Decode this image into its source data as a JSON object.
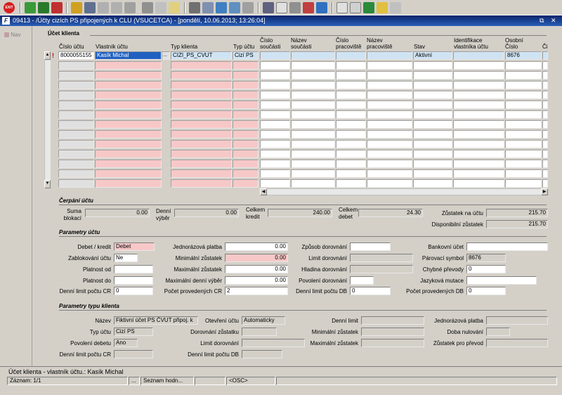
{
  "toolbar": {
    "exit_label": "EXIT",
    "icons": [
      "exit-icon",
      "add-record-icon",
      "save-icon",
      "delete-icon",
      "find-icon",
      "query-icon",
      "sort-asc-icon",
      "sort-desc-icon",
      "filter-icon",
      "print-icon",
      "copy-icon",
      "mail-icon",
      "cut-icon",
      "paste-icon",
      "lookup-icon",
      "attach-icon",
      "grid-icon",
      "calc-icon",
      "document-icon",
      "tools-icon",
      "chart-icon",
      "edit-icon",
      "refresh-icon",
      "sum-icon",
      "excel-icon",
      "help-icon",
      "context-help-icon"
    ]
  },
  "window": {
    "title": "09413 - /Účty cizích PS připojených k CLU (VSUCETCA) - [pondělí, 10.06.2013; 13:26:04]",
    "icon_letter": "F",
    "restore_glyph": "⧉",
    "close_glyph": "✕"
  },
  "nav": {
    "label": "Nav"
  },
  "account": {
    "section": "Účet klienta",
    "headers": {
      "cislo_uctu": "Číslo účtu",
      "vlastnik": "Vlastník účtu",
      "typ_klienta": "Typ klienta",
      "typ_uctu": "Typ účtu",
      "cislo_soucasti_1": "Číslo",
      "cislo_soucasti_2": "součásti",
      "nazev_soucasti_1": "Název",
      "nazev_soucasti_2": "součásti",
      "cislo_prac_1": "Číslo",
      "cislo_prac_2": "pracoviště",
      "nazev_prac_1": "Název",
      "nazev_prac_2": "pracoviště",
      "stav": "Stav",
      "identifikace_1": "Identifikace",
      "identifikace_2": "vlastníka účtu",
      "osobni_1": "Osobní",
      "osobni_2": "Číslo",
      "ci": "Či"
    },
    "row": {
      "marker": "!",
      "cislo_uctu": "8000055155",
      "vlastnik": "Kasík Michal",
      "ellipsis": "...",
      "typ_klienta": "CIZI_PS_CVUT",
      "typ_uctu": "Cizí PS",
      "stav": "Aktivní",
      "osobni": "8676"
    }
  },
  "cerpani": {
    "section": "Čerpání účtu",
    "suma_label_1": "Suma",
    "suma_label_2": "blokací",
    "suma_value": "0.00",
    "vyber_label_1": "Denní",
    "vyber_label_2": "výběr",
    "vyber_value": "0.00",
    "kredit_label_1": "Celkem",
    "kredit_label_2": "kredit",
    "kredit_value": "240.00",
    "debet_label_1": "Celkem",
    "debet_label_2": "debet",
    "debet_value": "24.30",
    "zustatek_label": "Zůstatek na účtu",
    "zustatek_value": "215.70",
    "disponibilni_label": "Disponibilní zůstatek",
    "disponibilni_value": "215.70"
  },
  "parametry": {
    "section": "Parametry účtu",
    "debet_kredit_label": "Debet / kredit",
    "debet_kredit_value": "Debet",
    "zablokovani_label": "Zablokování účtu",
    "zablokovani_value": "Ne",
    "platnost_od_label": "Platnost od",
    "platnost_do_label": "Platnost do",
    "denni_limit_cr_label": "Denní limit počtu CR",
    "denni_limit_cr_value": "0",
    "jednorazova_label": "Jednorázová platba",
    "jednorazova_value": "0.00",
    "min_zustatek_label": "Minimální zůstatek",
    "min_zustatek_value": "0.00",
    "max_zustatek_label": "Maximální zůstatek",
    "max_zustatek_value": "0.00",
    "max_vyber_label": "Maximální denní výběr",
    "max_vyber_value": "0.00",
    "pocet_cr_label": "Počet provedených CR",
    "pocet_cr_value": "2",
    "zpusob_label": "Způsob dorovnání",
    "limit_dorovnani_label": "Limit dorovnání",
    "hladina_label": "Hladina dorovnání",
    "povoleni_dorovnani_label": "Povolení dorovnání",
    "denni_limit_db_label": "Denní limit počtu DB",
    "denni_limit_db_value": "0",
    "bankovni_label": "Bankovní účet",
    "parovaci_label": "Párovací symbol",
    "parovaci_value": "8676",
    "chybne_label": "Chybné převody",
    "chybne_value": "0",
    "jazykova_label": "Jazyková mutace",
    "pocet_db_label": "Počet provedených DB",
    "pocet_db_value": "0"
  },
  "typ_klienta": {
    "section": "Parametry typu klienta",
    "nazev_label": "Název",
    "nazev_value": "Fiktivní účet PS ČVUT připoj. k",
    "otevreni_label": "Otevření účtu",
    "otevreni_value": "Automaticky",
    "typ_uctu_label": "Typ účtu",
    "typ_uctu_value": "Cizí PS",
    "dorovnani_zust_label": "Dorovnání zůstatku",
    "povoleni_debetu_label": "Povolení debetu",
    "povoleni_debetu_value": "Ano",
    "limit_dorovnani_label": "Limit dorovnání",
    "denni_limit_cr_label": "Denní limit počtu CR",
    "denni_limit_db_label": "Denní limit počtu DB",
    "denni_limit_label": "Denní limit",
    "min_zustatek_label": "Minimální zůstatek",
    "max_zustatek_label": "Maximální zůstatek",
    "jednorazova_label": "Jednorázová platba",
    "doba_nulovani_label": "Doba nulování",
    "zustatek_prevod_label": "Zůstatek pro převod"
  },
  "status": {
    "message": "Účet klienta - vlastník účtu.: Kasík Michal",
    "zaznam": "Záznam: 1/1",
    "dots": "...",
    "seznam": "Seznam hodn...",
    "osc": "<OSC>"
  }
}
